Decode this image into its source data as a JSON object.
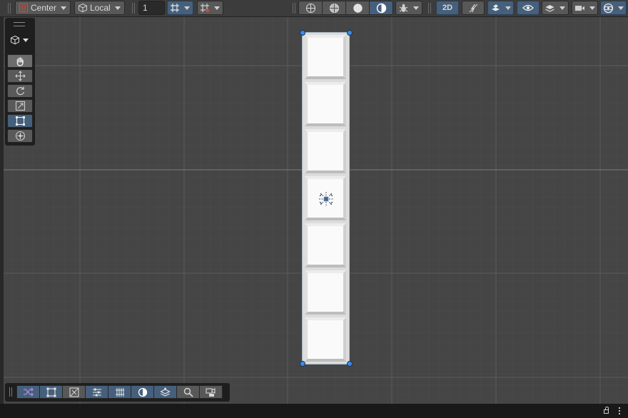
{
  "toolbar": {
    "pivot_label": "Center",
    "space_label": "Local",
    "grid_size_value": "1",
    "two_d_label": "2D"
  },
  "tools": [
    "view-tool",
    "move-tool",
    "rotate-tool",
    "scale-tool",
    "rect-tool",
    "transform-tool"
  ],
  "active_tool": "rect-tool",
  "scene": {
    "tile_count": 7,
    "selection_color": "#3f8be6",
    "background_color": "#454545"
  },
  "overlay_buttons": [
    "shuffle-icon",
    "rect-icon",
    "pivot-icon",
    "sliders-icon",
    "grid-icon",
    "shading-icon",
    "layers-icon",
    "search-icon",
    "camera-icon"
  ],
  "colors": {
    "accent": "#46607c",
    "toolbar": "#3c3c3c",
    "button": "#585858"
  }
}
